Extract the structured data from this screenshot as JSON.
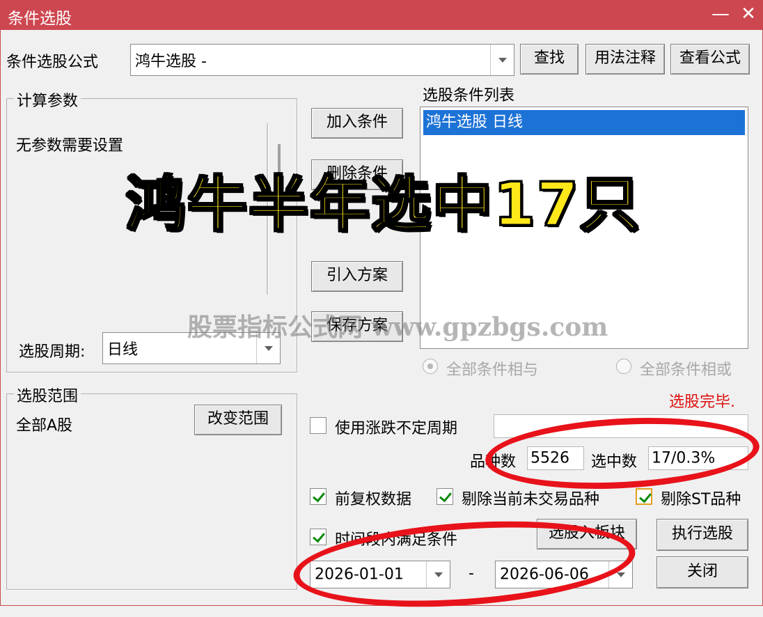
{
  "window": {
    "title": "条件选股",
    "minimize_glyph": "—",
    "close_glyph": "✕"
  },
  "formula": {
    "label": "条件选股公式",
    "value": "鸿牛选股  -",
    "find_button": "查找",
    "usage_button": "用法注释",
    "view_button": "查看公式"
  },
  "params": {
    "group_label": "计算参数",
    "no_params_text": "无参数需要设置",
    "period_label": "选股周期:",
    "period_value": "日线"
  },
  "middle_buttons": {
    "add_condition": "加入条件",
    "delete_condition": "删除条件",
    "import_plan": "引入方案",
    "save_plan": "保存方案"
  },
  "conditions": {
    "list_label": "选股条件列表",
    "items": [
      "鸿牛选股  日线"
    ],
    "radio_and": "全部条件相与",
    "radio_or": "全部条件相或"
  },
  "range": {
    "group_label": "选股范围",
    "value": "全部A股",
    "change_button": "改变范围"
  },
  "status": {
    "done_text": "选股完毕.",
    "done_color": "#e01010"
  },
  "options": {
    "use_float_period": "使用涨跌不定周期",
    "total_label": "品种数",
    "total_value": "5526",
    "selected_label": "选中数",
    "selected_value": "17/0.3%",
    "prev_adjust": "前复权数据",
    "exclude_untraded": "剔除当前未交易品种",
    "exclude_st": "剔除ST品种",
    "time_range": "时间段内满足条件",
    "to_block_button": "选股入板块",
    "execute_button": "执行选股",
    "close_button": "关闭",
    "date_from": "2026-01-01",
    "date_sep": "-",
    "date_to": "2026-06-06"
  },
  "overlay": {
    "headline": "鸿牛半年选中17只",
    "headline_color": "#ffe81a",
    "watermark": "股票指标公式网 www.gpzbgs.com",
    "ring_color": "#e8121a"
  }
}
